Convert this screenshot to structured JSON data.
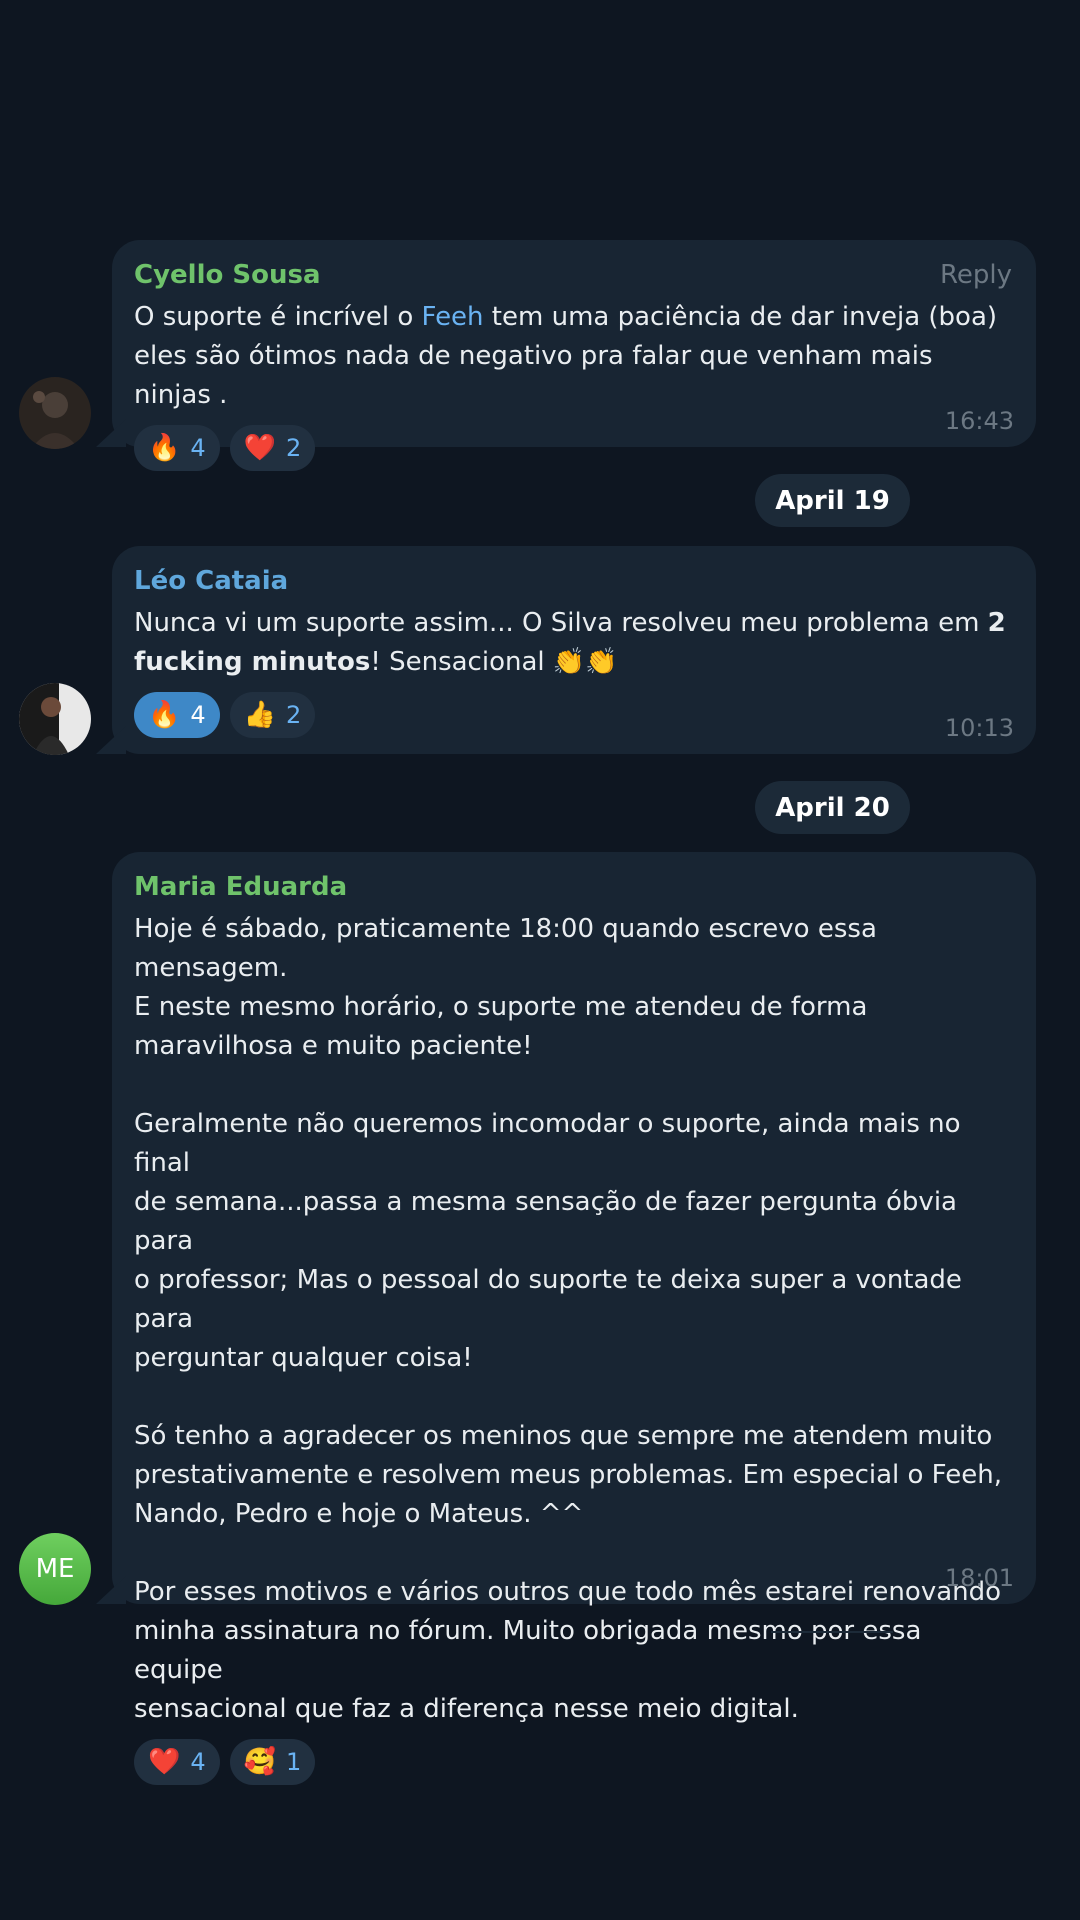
{
  "messages": [
    {
      "author": "Cyello Sousa",
      "author_color": "#6fc36b",
      "reply_label": "Reply",
      "text_a": "O suporte é incrível o ",
      "link": "Feeh",
      "text_b": " tem uma paciência de dar inveja (boa)\neles são ótimos nada de negativo pra falar que venham mais ninjas .",
      "reactions": [
        {
          "icon": "fire-icon",
          "emoji": "🔥",
          "count": "4"
        },
        {
          "icon": "heart-icon",
          "emoji": "❤️",
          "count": "2"
        }
      ],
      "time": "16:43"
    },
    {
      "author": "Léo Cataia",
      "author_color": "#5fa7dc",
      "text_a": "Nunca vi um suporte assim... O Silva resolveu meu problema em ",
      "bold": "2\nfucking minutos",
      "text_b": "! Sensacional ",
      "emoji_inline": "👏👏",
      "reactions": [
        {
          "icon": "fire-icon",
          "emoji": "🔥",
          "count": "4",
          "active": true
        },
        {
          "icon": "thumbs-up-icon",
          "emoji": "👍",
          "count": "2"
        }
      ],
      "time": "10:13"
    },
    {
      "author": "Maria Eduarda",
      "author_color": "#6fc36b",
      "avatar_initials": "ME",
      "text": "Hoje é sábado, praticamente 18:00 quando escrevo essa mensagem.\nE neste mesmo horário, o suporte me atendeu de forma\nmaravilhosa e muito paciente!\n\nGeralmente não queremos incomodar o suporte, ainda mais no final\nde semana...passa a mesma sensação de fazer pergunta óbvia para\no professor; Mas o pessoal do suporte te deixa super a vontade para\nperguntar qualquer coisa!\n\nSó tenho a agradecer os meninos que sempre me atendem muito\nprestativamente e resolvem meus problemas. Em especial o Feeh,\nNando, Pedro e hoje o Mateus. ^^\n\nPor esses motivos e vários outros que todo mês estarei renovando\nminha assinatura no fórum. Muito obrigada mesmo por essa equipe\nsensacional que faz a diferença nesse meio digital.",
      "reactions": [
        {
          "icon": "heart-icon",
          "emoji": "❤️",
          "count": "4"
        },
        {
          "icon": "smiling-face-hearts-icon",
          "emoji": "🥰",
          "count": "1"
        }
      ],
      "time": "18:01"
    }
  ],
  "dates": [
    "April 19",
    "April 20"
  ]
}
